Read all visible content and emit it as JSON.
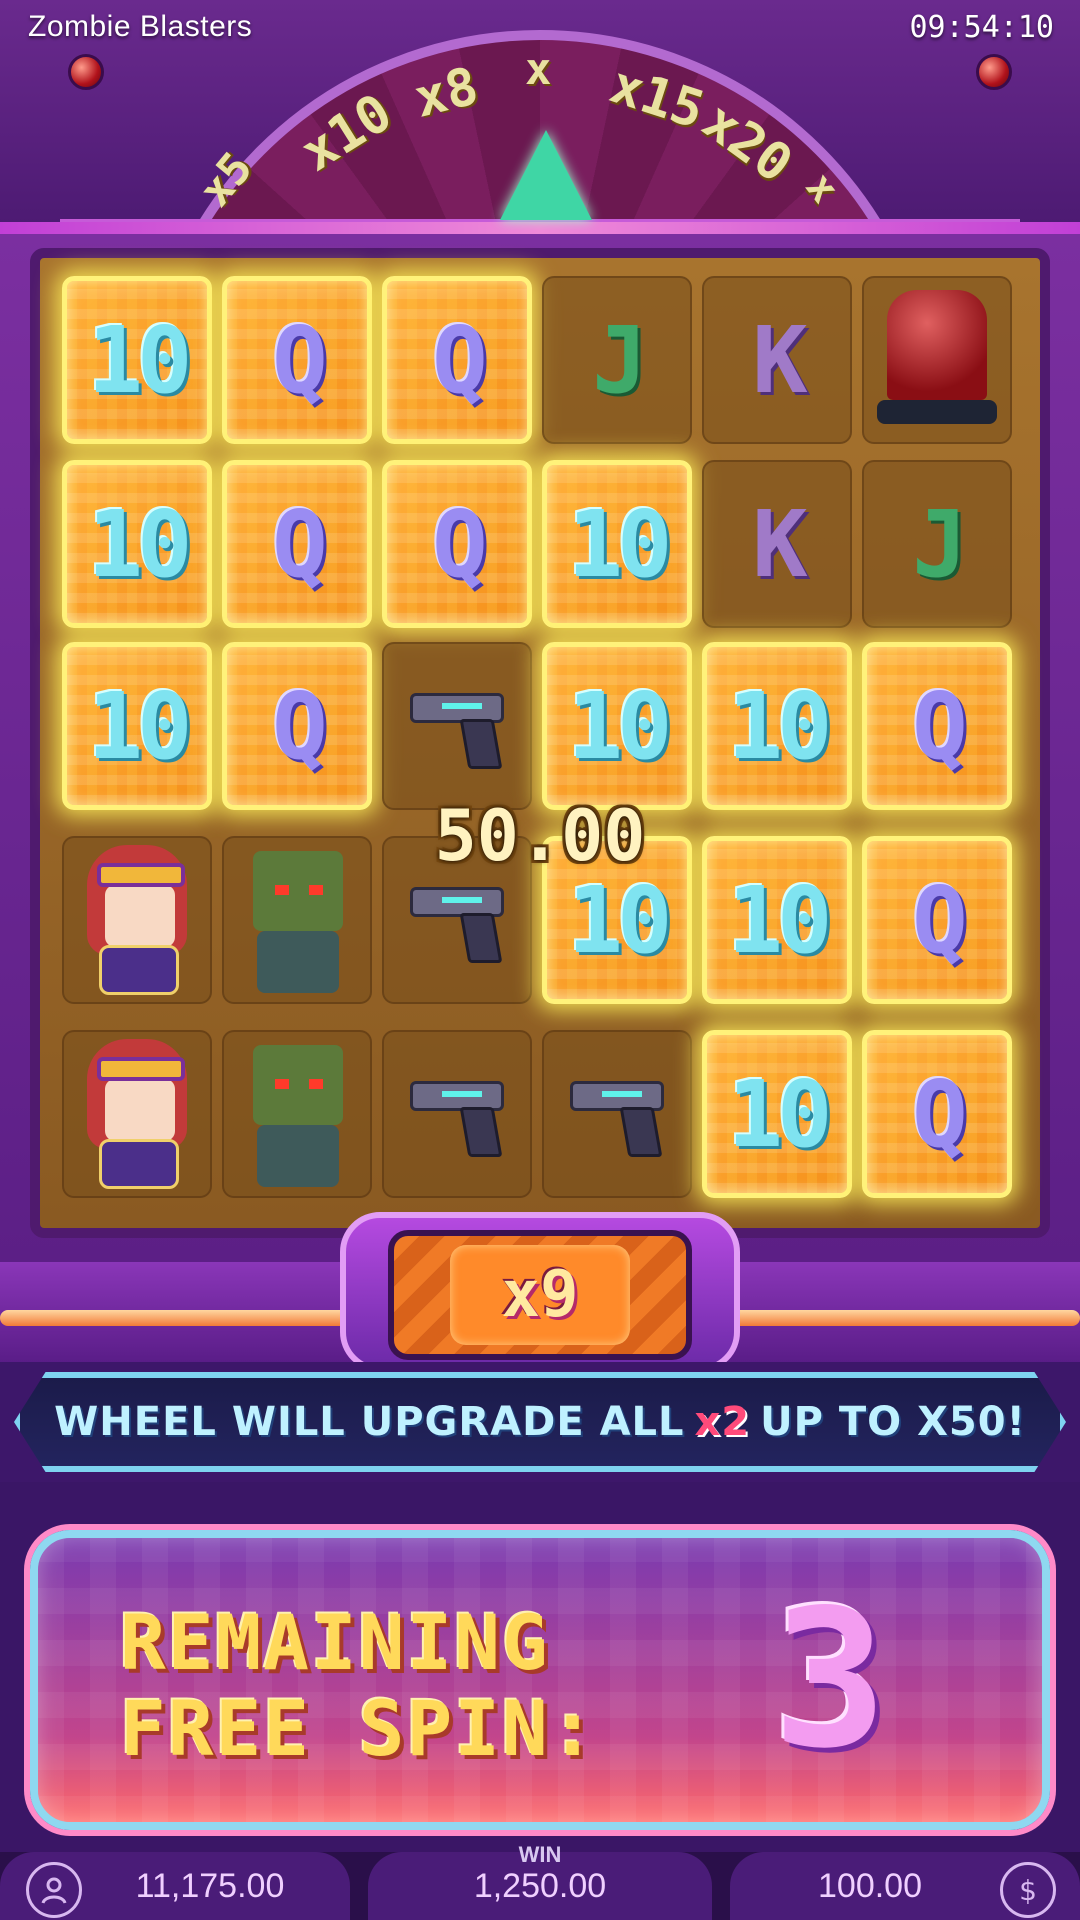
{
  "app_title": "Zombie Blasters",
  "clock": "09:54:10",
  "wheel": {
    "segments": [
      "x5",
      "x10",
      "x8",
      "x",
      "x15",
      "x20",
      "x"
    ]
  },
  "board": {
    "rows": [
      [
        {
          "symbol": "10",
          "win": true
        },
        {
          "symbol": "Q",
          "win": true
        },
        {
          "symbol": "Q",
          "win": true
        },
        {
          "symbol": "J",
          "win": false
        },
        {
          "symbol": "K",
          "win": false
        },
        {
          "symbol": "siren",
          "win": false
        }
      ],
      [
        {
          "symbol": "10",
          "win": true
        },
        {
          "symbol": "Q",
          "win": true
        },
        {
          "symbol": "Q",
          "win": true
        },
        {
          "symbol": "10",
          "win": true
        },
        {
          "symbol": "K",
          "win": false
        },
        {
          "symbol": "J",
          "win": false
        }
      ],
      [
        {
          "symbol": "10",
          "win": true
        },
        {
          "symbol": "Q",
          "win": true
        },
        {
          "symbol": "gun",
          "win": false
        },
        {
          "symbol": "10",
          "win": true
        },
        {
          "symbol": "10",
          "win": true
        },
        {
          "symbol": "Q",
          "win": true
        }
      ],
      [
        {
          "symbol": "hero",
          "win": false
        },
        {
          "symbol": "zombie",
          "win": false
        },
        {
          "symbol": "gun",
          "win": false
        },
        {
          "symbol": "10",
          "win": true
        },
        {
          "symbol": "10",
          "win": true
        },
        {
          "symbol": "Q",
          "win": true
        }
      ],
      [
        {
          "symbol": "hero",
          "win": false
        },
        {
          "symbol": "zombie",
          "win": false
        },
        {
          "symbol": "gun",
          "win": false
        },
        {
          "symbol": "gun",
          "win": false
        },
        {
          "symbol": "10",
          "win": true
        },
        {
          "symbol": "Q",
          "win": true
        }
      ]
    ],
    "win_amount": "50.00"
  },
  "multiplier": "x9",
  "banner": {
    "text_before": "WHEEL WILL UPGRADE ALL",
    "highlight": "x2",
    "text_after": "UP TO X50!"
  },
  "free_spins": {
    "label_line1": "REMAINING",
    "label_line2": "FREE SPIN:",
    "count": "3"
  },
  "footer": {
    "balance": "11,175.00",
    "win_label": "WIN",
    "win_value": "1,250.00",
    "bet": "100.00",
    "account_icon": "user-menu-icon",
    "bet_icon": "dollar-coin-icon"
  },
  "colors": {
    "win_cell": "#f58f1a",
    "win_glow": "#fff27a",
    "banner_border": "#7fd3f0",
    "highlight": "#ff4a7a"
  }
}
